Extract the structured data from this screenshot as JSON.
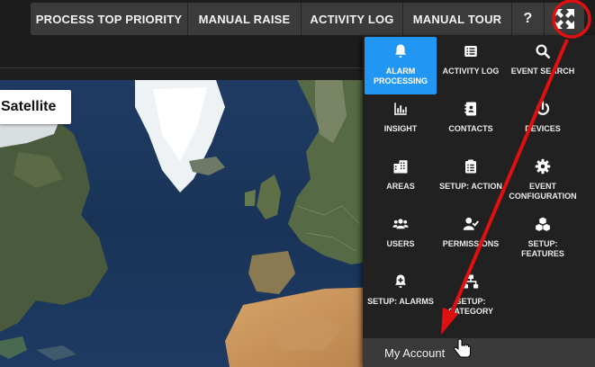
{
  "toolbar": {
    "buttons": [
      {
        "label": "PROCESS TOP PRIORITY"
      },
      {
        "label": "MANUAL RAISE"
      },
      {
        "label": "ACTIVITY LOG"
      },
      {
        "label": "MANUAL TOUR"
      }
    ],
    "help_label": "?",
    "expand_icon": "expand-arrows-icon"
  },
  "map": {
    "satellite_label": "Satellite"
  },
  "menu": {
    "items": [
      {
        "label": "ALARM PROCESSING",
        "icon": "bell-icon",
        "active": true
      },
      {
        "label": "ACTIVITY LOG",
        "icon": "list-icon"
      },
      {
        "label": "EVENT SEARCH",
        "icon": "search-icon"
      },
      {
        "label": "INSIGHT",
        "icon": "bar-chart-icon"
      },
      {
        "label": "CONTACTS",
        "icon": "contact-book-icon"
      },
      {
        "label": "DEVICES",
        "icon": "power-icon"
      },
      {
        "label": "AREAS",
        "icon": "buildings-icon"
      },
      {
        "label": "SETUP: ACTION",
        "icon": "clipboard-icon"
      },
      {
        "label": "EVENT CONFIGURATION",
        "icon": "gear-icon"
      },
      {
        "label": "USERS",
        "icon": "users-icon"
      },
      {
        "label": "PERMISSIONS",
        "icon": "user-check-icon"
      },
      {
        "label": "SETUP: FEATURES",
        "icon": "cubes-icon"
      },
      {
        "label": "SETUP: ALARMS",
        "icon": "bell-plus-icon"
      },
      {
        "label": "SETUP: CATEGORY",
        "icon": "sitemap-icon"
      }
    ],
    "account_label": "My Account"
  },
  "colors": {
    "accent": "#2196f3",
    "annotation": "#e01010"
  }
}
